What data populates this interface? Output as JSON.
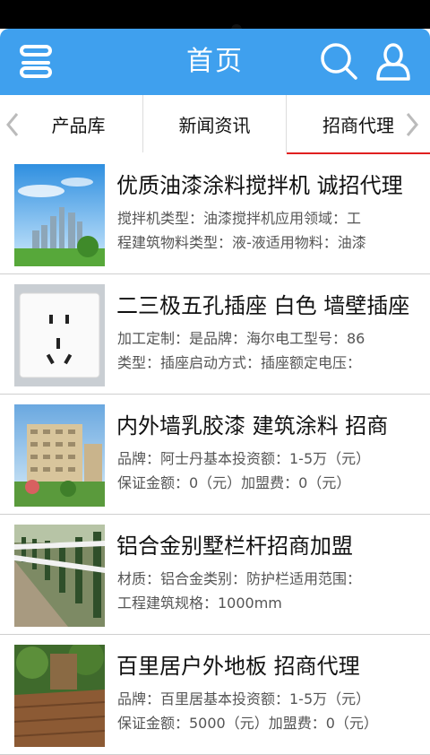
{
  "header": {
    "title": "首页",
    "menu_icon": "menu-icon",
    "search_icon": "search-icon",
    "user_icon": "user-icon",
    "background_color": "#3fa0ee"
  },
  "tabs": [
    {
      "label": "产品库",
      "active": false
    },
    {
      "label": "新闻资讯",
      "active": false
    },
    {
      "label": "招商代理",
      "active": true
    }
  ],
  "active_tab_color": "#e02020",
  "items": [
    {
      "title": "优质油漆涂料搅拌机 诚招代理",
      "desc_line1": "搅拌机类型：油漆搅拌机应用领域：工",
      "desc_line2": "程建筑物料类型：液-液适用物料：油漆",
      "image": "city-skyline-image"
    },
    {
      "title": "二三极五孔插座 白色 墙壁插座",
      "desc_line1": "加工定制：是品牌：海尔电工型号：86",
      "desc_line2": "类型：插座启动方式：插座额定电压：",
      "image": "wall-socket-image"
    },
    {
      "title": "内外墙乳胶漆 建筑涂料 招商",
      "desc_line1": "品牌：阿士丹基本投资额：1-5万（元）",
      "desc_line2": "保证金额：0（元）加盟费：0（元）",
      "image": "apartment-building-image"
    },
    {
      "title": "铝合金别墅栏杆招商加盟",
      "desc_line1": "材质：铝合金类别：防护栏适用范围：",
      "desc_line2": "工程建筑规格：1000mm",
      "image": "fence-railing-image"
    },
    {
      "title": "百里居户外地板 招商代理",
      "desc_line1": "品牌：百里居基本投资额：1-5万（元）",
      "desc_line2": "保证金额：5000（元）加盟费：0（元）",
      "image": "outdoor-floor-image"
    }
  ]
}
